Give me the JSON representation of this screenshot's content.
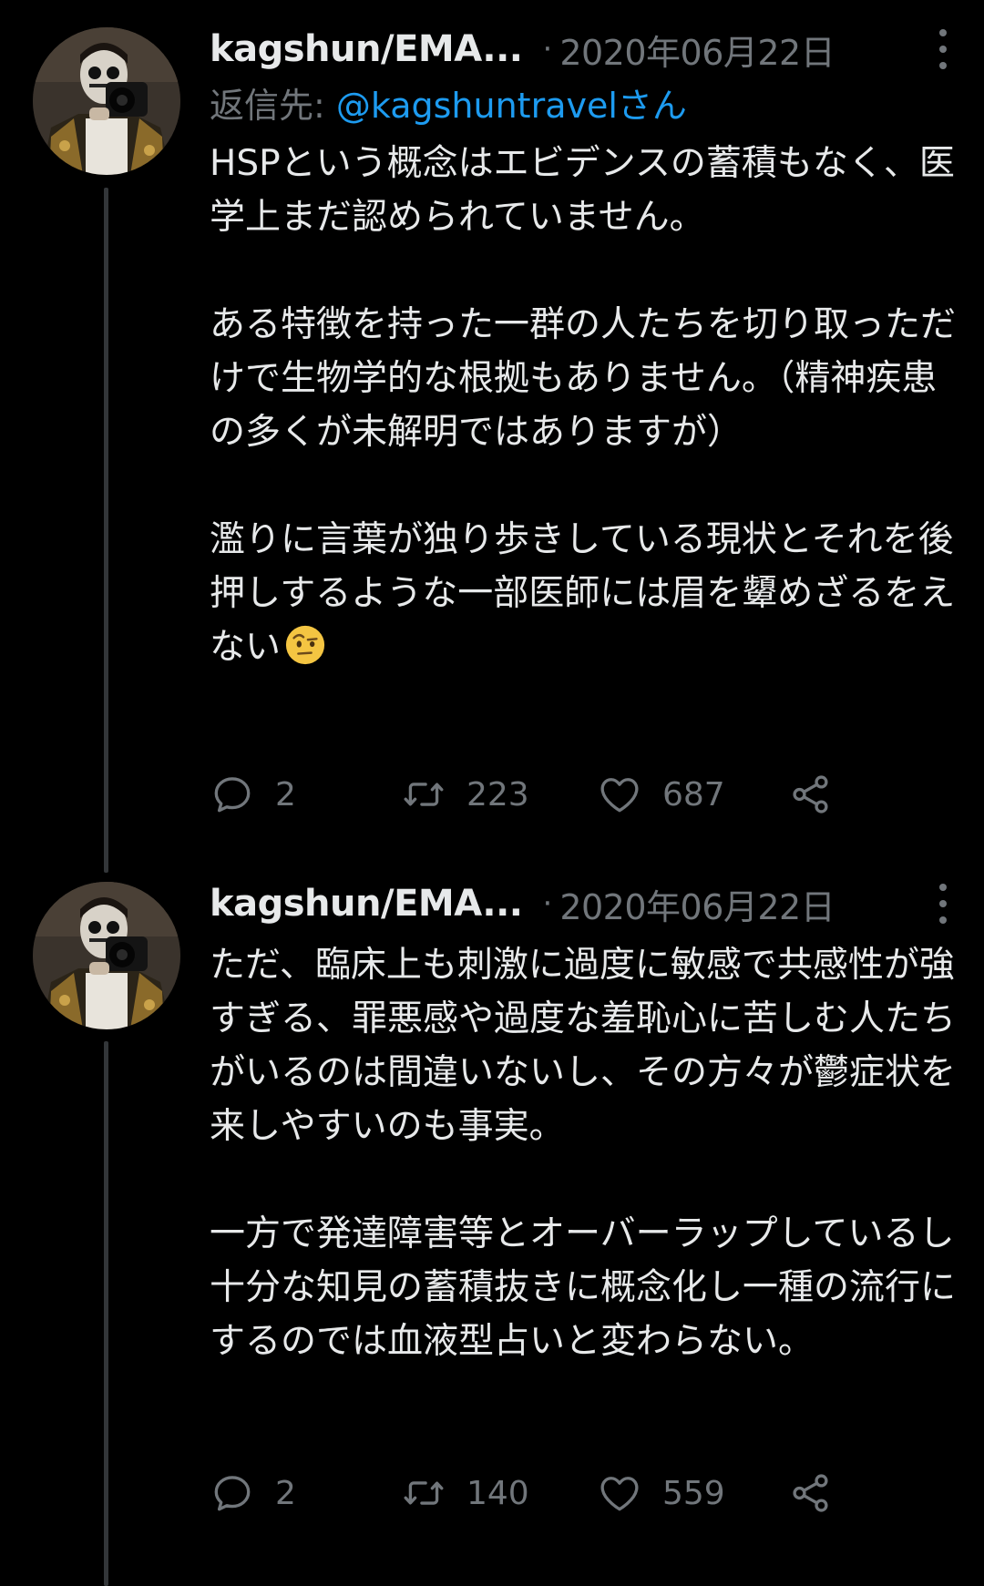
{
  "colors": {
    "background": "#000000",
    "text": "#e7e9ea",
    "muted": "#71767b",
    "link": "#1d9bf0",
    "thread_line": "#333639"
  },
  "tweets": [
    {
      "display_name": "kagshun/EMA...",
      "separator": "·",
      "timestamp": "2020年06月22日",
      "reply_prefix": "返信先: ",
      "reply_mention": "@kagshuntravel",
      "reply_suffix": "さん",
      "body": "HSPという概念はエビデンスの蓄積もなく、医学上まだ認められていません。\n\nある特徴を持った一群の人たちを切り取っただけで生物学的な根拠もありません。（精神疾患の多くが未解明ではありますが）\n\n濫りに言葉が独り歩きしている現状とそれを後押しするような一部医師には眉を顰めざるをえない",
      "emoji": "face-with-raised-eyebrow",
      "replies": "2",
      "retweets": "223",
      "likes": "687"
    },
    {
      "display_name": "kagshun/EMA...",
      "separator": "·",
      "timestamp": "2020年06月22日",
      "body": "ただ、臨床上も刺激に過度に敏感で共感性が強すぎる、罪悪感や過度な羞恥心に苦しむ人たちがいるのは間違いないし、その方々が鬱症状を来しやすいのも事実。\n\n一方で発達障害等とオーバーラップしているし十分な知見の蓄積抜きに概念化し一種の流行にするのでは血液型占いと変わらない。",
      "replies": "2",
      "retweets": "140",
      "likes": "559"
    }
  ],
  "icons": {
    "reply": "reply-icon",
    "retweet": "retweet-icon",
    "like": "heart-icon",
    "share": "share-icon",
    "more": "more-options-icon"
  }
}
